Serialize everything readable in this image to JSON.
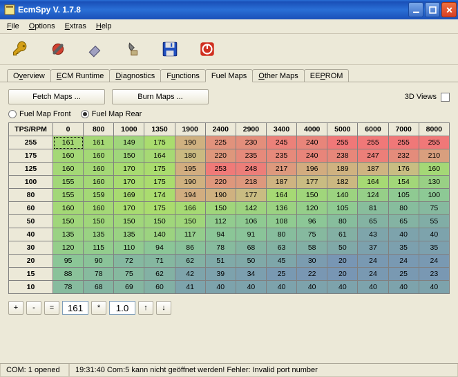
{
  "window": {
    "title": "EcmSpy V. 1.7.8"
  },
  "menu": {
    "file": "File",
    "options": "Options",
    "extras": "Extras",
    "help": "Help"
  },
  "tabs": {
    "overview": "Overview",
    "ecm": "ECM Runtime",
    "diag": "Diagnostics",
    "func": "Functions",
    "fuel": "Fuel Maps",
    "other": "Other Maps",
    "eeprom": "EEPROM"
  },
  "buttons": {
    "fetch": "Fetch Maps ...",
    "burn": "Burn Maps ...",
    "views": "3D Views"
  },
  "radios": {
    "front": "Fuel Map Front",
    "rear": "Fuel Map Rear"
  },
  "controls": {
    "plus": "+",
    "minus": "-",
    "eq": "=",
    "val": "161",
    "mul": "*",
    "factor": "1.0",
    "up": "↑",
    "down": "↓"
  },
  "corner": "TPS/RPM",
  "cols": [
    "0",
    "800",
    "1000",
    "1350",
    "1900",
    "2400",
    "2900",
    "3400",
    "4000",
    "5000",
    "6000",
    "7000",
    "8000"
  ],
  "rows": [
    "255",
    "175",
    "125",
    "100",
    "80",
    "60",
    "50",
    "40",
    "30",
    "20",
    "15",
    "10"
  ],
  "chart_data": {
    "type": "heatmap",
    "title": "Fuel Map Rear",
    "xlabel": "RPM",
    "ylabel": "TPS",
    "cols": [
      "0",
      "800",
      "1000",
      "1350",
      "1900",
      "2400",
      "2900",
      "3400",
      "4000",
      "5000",
      "6000",
      "7000",
      "8000"
    ],
    "rows": [
      "255",
      "175",
      "125",
      "100",
      "80",
      "60",
      "50",
      "40",
      "30",
      "20",
      "15",
      "10"
    ],
    "values": [
      [
        161,
        161,
        149,
        175,
        190,
        225,
        230,
        245,
        240,
        255,
        255,
        255,
        255
      ],
      [
        160,
        160,
        150,
        164,
        180,
        220,
        235,
        235,
        240,
        238,
        247,
        232,
        210
      ],
      [
        160,
        160,
        170,
        175,
        195,
        253,
        248,
        217,
        196,
        189,
        187,
        176,
        160
      ],
      [
        155,
        160,
        170,
        175,
        190,
        220,
        218,
        187,
        177,
        182,
        164,
        154,
        130
      ],
      [
        155,
        159,
        169,
        174,
        194,
        190,
        177,
        164,
        150,
        140,
        124,
        105,
        100
      ],
      [
        160,
        160,
        170,
        175,
        166,
        150,
        142,
        136,
        120,
        105,
        81,
        80,
        75
      ],
      [
        150,
        150,
        150,
        150,
        150,
        112,
        106,
        108,
        96,
        80,
        65,
        65,
        55
      ],
      [
        135,
        135,
        135,
        140,
        117,
        94,
        91,
        80,
        75,
        61,
        43,
        40,
        40
      ],
      [
        120,
        115,
        110,
        94,
        86,
        78,
        68,
        63,
        58,
        50,
        37,
        35,
        35
      ],
      [
        95,
        90,
        72,
        71,
        62,
        51,
        50,
        45,
        30,
        20,
        24,
        24,
        24
      ],
      [
        88,
        78,
        75,
        62,
        42,
        39,
        34,
        25,
        22,
        20,
        24,
        25,
        23
      ],
      [
        78,
        68,
        69,
        60,
        41,
        40,
        40,
        40,
        40,
        40,
        40,
        40,
        40
      ]
    ],
    "vmin": 20,
    "vmax": 255
  },
  "status": {
    "com": "COM: 1 opened",
    "msg": "19:31:40 Com:5 kann nicht geöffnet werden! Fehler: Invalid port number"
  }
}
